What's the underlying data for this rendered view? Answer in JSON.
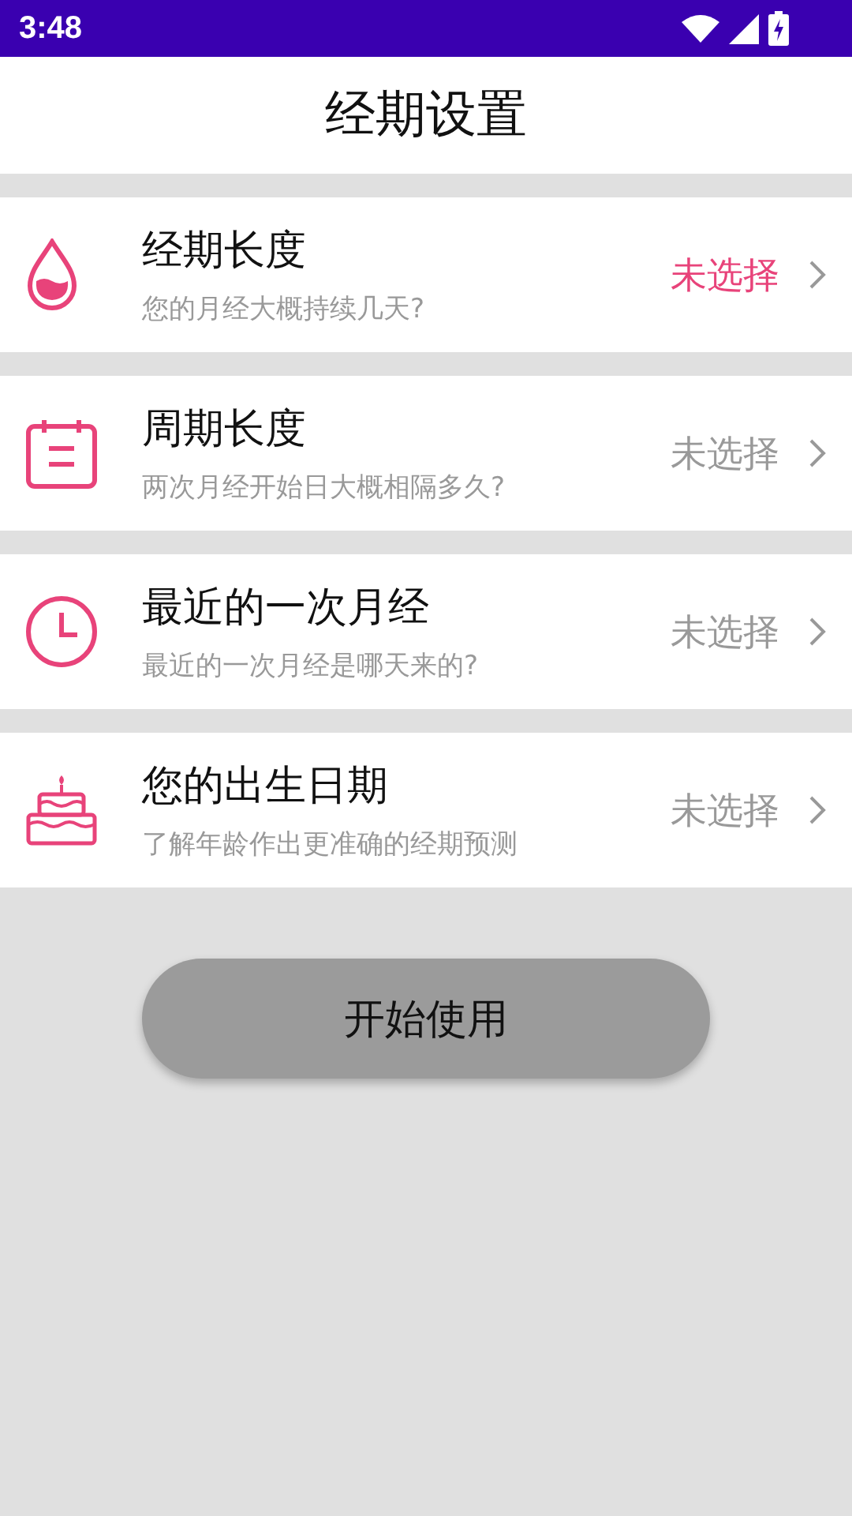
{
  "status_bar": {
    "time": "3:48"
  },
  "header": {
    "title": "经期设置"
  },
  "settings": [
    {
      "kind": "drop",
      "title": "经期长度",
      "subtitle": "您的月经大概持续几天?",
      "value": "未选择",
      "highlighted": true
    },
    {
      "kind": "calendar",
      "title": "周期长度",
      "subtitle": "两次月经开始日大概相隔多久?",
      "value": "未选择",
      "highlighted": false
    },
    {
      "kind": "clock",
      "title": "最近的一次月经",
      "subtitle": "最近的一次月经是哪天来的?",
      "value": "未选择",
      "highlighted": false
    },
    {
      "kind": "cake",
      "title": "您的出生日期",
      "subtitle": "了解年龄作出更准确的经期预测",
      "value": "未选择",
      "highlighted": false
    }
  ],
  "start_button": {
    "label": "开始使用"
  }
}
